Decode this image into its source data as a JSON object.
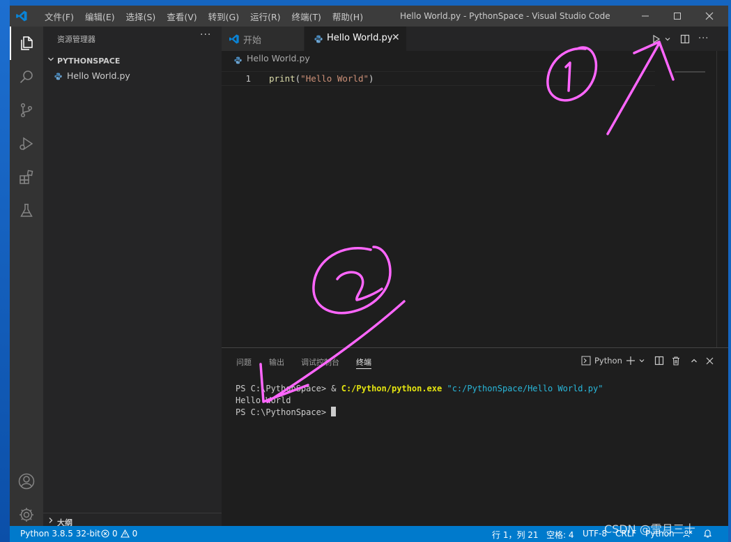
{
  "window": {
    "title": "Hello World.py - PythonSpace - Visual Studio Code",
    "menu": [
      "文件(F)",
      "编辑(E)",
      "选择(S)",
      "查看(V)",
      "转到(G)",
      "运行(R)",
      "终端(T)",
      "帮助(H)"
    ]
  },
  "sidebar": {
    "header": "资源管理器",
    "folder": "PYTHONSPACE",
    "file": "Hello World.py",
    "outline": "大纲"
  },
  "tabs": [
    {
      "label": "开始",
      "active": false
    },
    {
      "label": "Hello World.py",
      "active": true
    }
  ],
  "editor": {
    "breadcrumb": "Hello World.py",
    "line_number": "1",
    "code": {
      "fn": "print",
      "open": "(",
      "str": "\"Hello World\"",
      "close": ")"
    }
  },
  "panel": {
    "tabs": [
      "问题",
      "输出",
      "调试控制台",
      "终端"
    ],
    "active_tab": "终端",
    "terminal_name": "Python",
    "terminal": {
      "prompt": "PS C:\\PythonSpace> ",
      "amp": "& ",
      "exe": "C:/Python/python.exe",
      "arg": "\"c:/PythonSpace/Hello World.py\"",
      "output": "Hello World",
      "prompt2": "PS C:\\PythonSpace> "
    }
  },
  "status": {
    "python": "Python 3.8.5 32-bit",
    "errors": "0",
    "warnings": "0",
    "position": "行 1，列 21",
    "spaces": "空格: 4",
    "encoding": "UTF-8",
    "eol": "CRLF",
    "language": "Python"
  },
  "watermark": "CSDN @雪月三十",
  "colors": {
    "accent": "#007acc",
    "annotation": "#ff66ff"
  }
}
